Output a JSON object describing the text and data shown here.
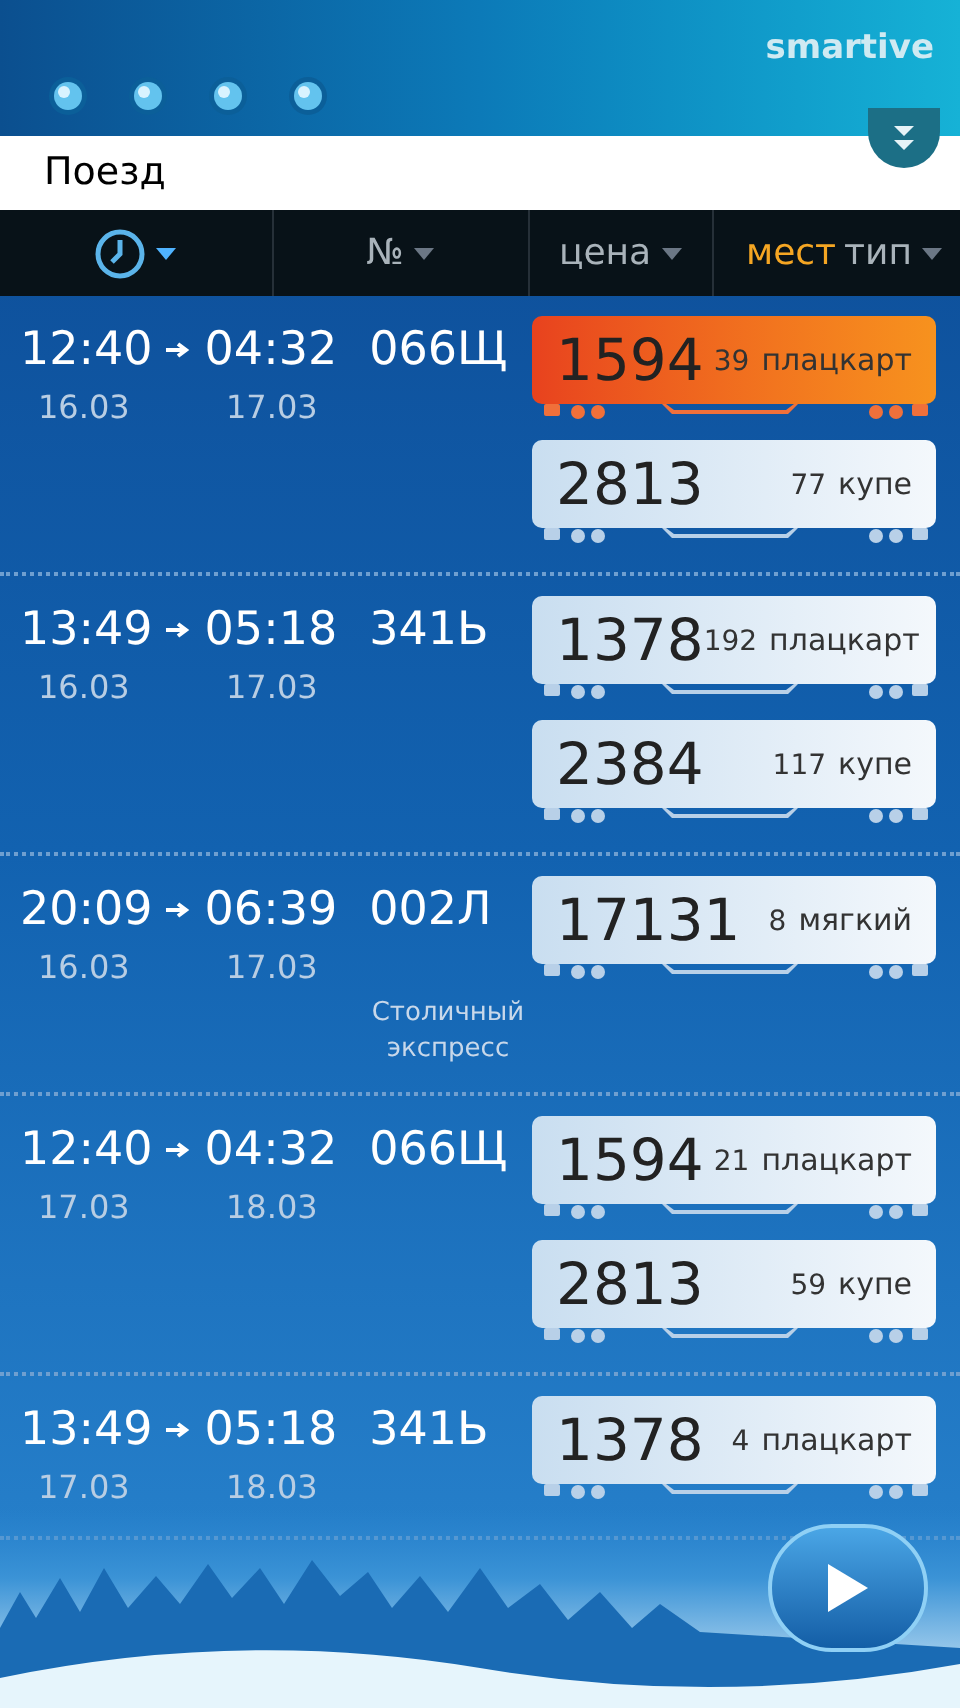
{
  "header": {
    "logo": "smartive"
  },
  "title": "Поезд",
  "columns": [
    {
      "kind": "time",
      "selected": true
    },
    {
      "kind": "text",
      "label": "№",
      "selected": false
    },
    {
      "kind": "text",
      "label": "цена",
      "selected": false
    },
    {
      "kind": "split",
      "label": "мест",
      "label2": "тип",
      "selected": true
    }
  ],
  "trains": [
    {
      "depart": "12:40",
      "arrive": "04:32",
      "number": "066Щ",
      "depart_date": "16.03",
      "arrive_date": "17.03",
      "tickets": [
        {
          "price": "1594",
          "seats": "39",
          "type": "плацкарт",
          "selected": true
        },
        {
          "price": "2813",
          "seats": "77",
          "type": "купе",
          "selected": false
        }
      ]
    },
    {
      "depart": "13:49",
      "arrive": "05:18",
      "number": "341Ь",
      "depart_date": "16.03",
      "arrive_date": "17.03",
      "tickets": [
        {
          "price": "1378",
          "seats": "192",
          "type": "плацкарт",
          "selected": false
        },
        {
          "price": "2384",
          "seats": "117",
          "type": "купе",
          "selected": false
        }
      ]
    },
    {
      "depart": "20:09",
      "arrive": "06:39",
      "number": "002Л",
      "name": "Столичный экспресс",
      "depart_date": "16.03",
      "arrive_date": "17.03",
      "tickets": [
        {
          "price": "17131",
          "seats": "8",
          "type": "мягкий",
          "selected": false
        }
      ]
    },
    {
      "depart": "12:40",
      "arrive": "04:32",
      "number": "066Щ",
      "depart_date": "17.03",
      "arrive_date": "18.03",
      "tickets": [
        {
          "price": "1594",
          "seats": "21",
          "type": "плацкарт",
          "selected": false
        },
        {
          "price": "2813",
          "seats": "59",
          "type": "купе",
          "selected": false
        }
      ]
    },
    {
      "depart": "13:49",
      "arrive": "05:18",
      "number": "341Ь",
      "depart_date": "17.03",
      "arrive_date": "18.03",
      "tickets": [
        {
          "price": "1378",
          "seats": "4",
          "type": "плацкарт",
          "selected": false
        }
      ]
    }
  ]
}
